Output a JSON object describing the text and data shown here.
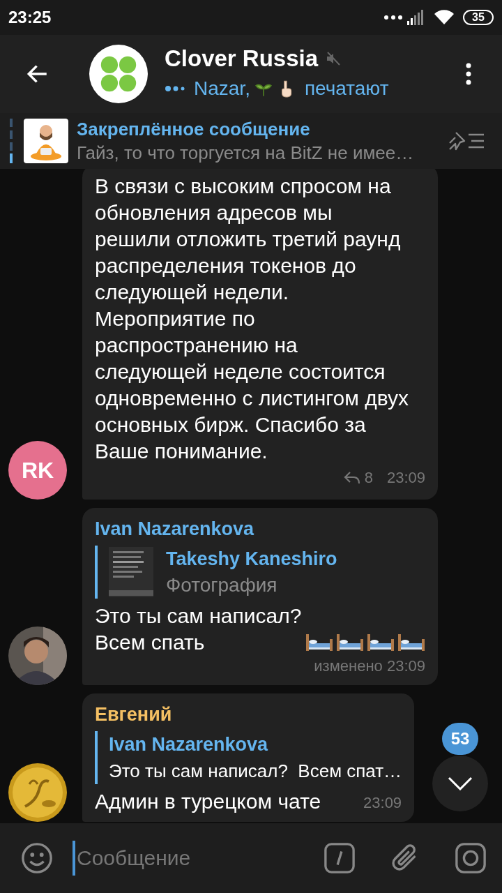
{
  "status_bar": {
    "time": "23:25",
    "battery": "35"
  },
  "header": {
    "title": "Clover Russia",
    "muted": true,
    "typing": {
      "names": "Nazar,",
      "emoji": [
        {
          "kind": "sprout"
        },
        {
          "kind": "pointing-hand"
        }
      ],
      "label": "печатают"
    }
  },
  "pinned": {
    "title": "Закреплённое сообщение",
    "text": "Гайз, то что торгуется на BitZ не имее…"
  },
  "messages": [
    {
      "avatar": {
        "kind": "initials",
        "text": "RK"
      },
      "text": "В связи с высоким спросом на обновления адресов мы решили отложить третий раунд распределения токенов до следующей недели. Мероприятие по распространению на следующей неделе состоится одновременно с листингом двух основных бирж. Спасибо за Ваше понимание.",
      "reply_count": "8",
      "time": "23:09"
    },
    {
      "sender": {
        "name": "Ivan Nazarenkova",
        "color": "#64b5ef"
      },
      "reply_to": {
        "name": "Takeshy Kaneshiro",
        "text": "Фотография"
      },
      "text": "Это ты сам написал?\nВсем спать",
      "emoji": [
        {
          "kind": "bed"
        },
        {
          "kind": "bed"
        },
        {
          "kind": "bed"
        },
        {
          "kind": "bed"
        }
      ],
      "time": "изменено 23:09"
    },
    {
      "avatar": {
        "kind": "coin"
      },
      "sender": {
        "name": "Евгений",
        "color": "#f5c063"
      },
      "reply_to": {
        "name": "Ivan Nazarenkova",
        "text": "Это ты сам написал?  Всем спат…"
      },
      "text": "Админ в турецком чате",
      "time": "23:09"
    }
  ],
  "scroll_button": {
    "badge": "53"
  },
  "composer": {
    "placeholder": "Сообщение"
  }
}
